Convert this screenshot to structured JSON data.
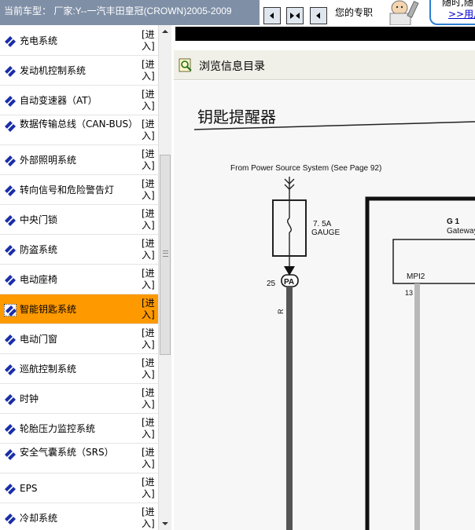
{
  "header": {
    "vehicle_label": "当前车型：  厂家:Y--一汽丰田皇冠(CROWN)2005-2009",
    "expert_label": "您的专职",
    "promo_line1": "随时,随",
    "promo_link": ">>用户"
  },
  "menu": {
    "enter_label": "[进入]",
    "items": [
      {
        "label": "充电系统"
      },
      {
        "label": "发动机控制系统"
      },
      {
        "label": "自动变速器（AT）"
      },
      {
        "label": "数据传输总线（CAN-BUS）"
      },
      {
        "label": "外部照明系统"
      },
      {
        "label": "转向信号和危险警告灯"
      },
      {
        "label": "中央门锁"
      },
      {
        "label": "防盗系统"
      },
      {
        "label": "电动座椅"
      },
      {
        "label": "智能钥匙系统",
        "selected": true
      },
      {
        "label": "电动门窗"
      },
      {
        "label": "巡航控制系统"
      },
      {
        "label": "时钟"
      },
      {
        "label": "轮胎压力监控系统"
      },
      {
        "label": "安全气囊系统（SRS）"
      },
      {
        "label": "EPS"
      },
      {
        "label": "冷却系统"
      }
    ]
  },
  "viewer": {
    "toolbar_label": "浏览信息目录",
    "doc": {
      "title": "钥匙提醒器",
      "source": "From Power Source System (See Page 92)",
      "fuse_rating": "7. 5A",
      "fuse_name": "GAUGE",
      "pin_number": "25",
      "connector": "PA",
      "wire_color": "R",
      "component_id": "G 1",
      "component_name": "Gateway",
      "connector2": "MPI2",
      "pin2": "13"
    }
  },
  "colors": {
    "header_bg": "#7f8fa6",
    "selected_bg": "#ff9900",
    "icon_blue": "#1a2ea8",
    "promo_border": "#2d7fd0"
  }
}
